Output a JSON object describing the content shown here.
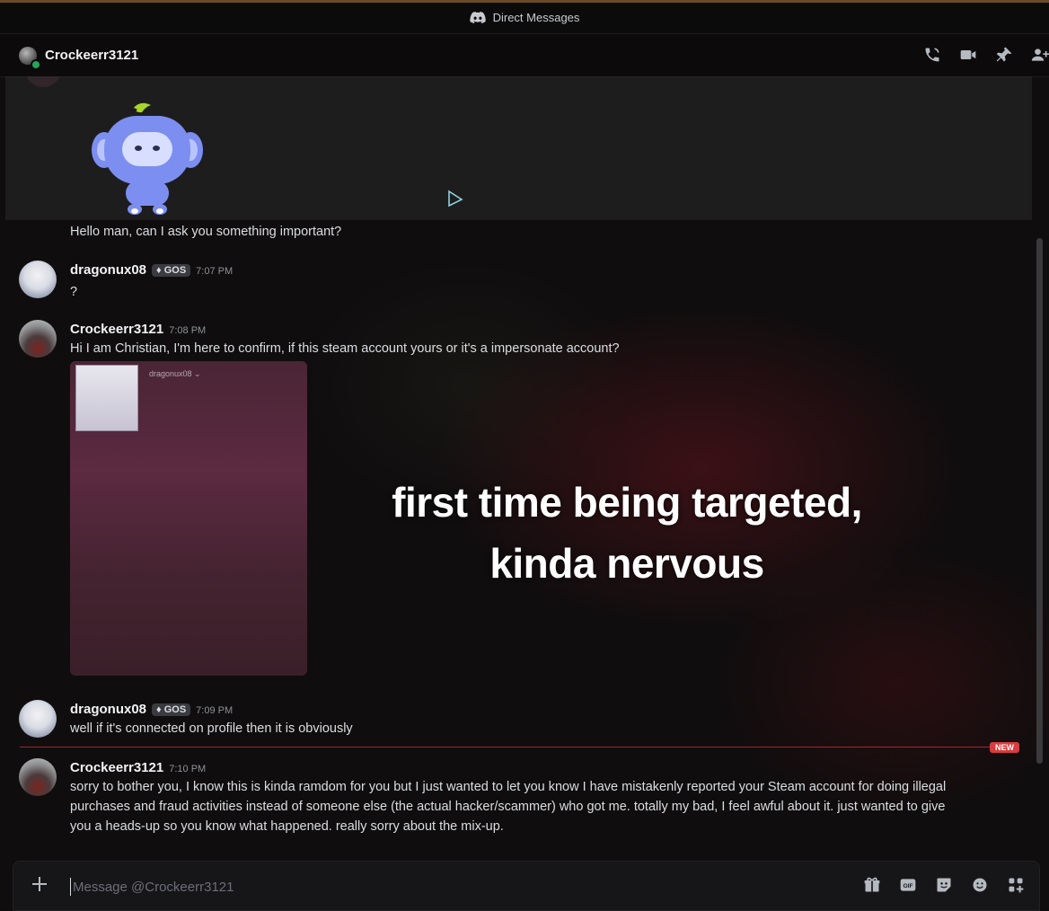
{
  "window": {
    "title": "Direct Messages"
  },
  "header": {
    "username": "Crockeerr3121"
  },
  "messages": [
    {
      "text": "Hello man, can I ask you something important?"
    },
    {
      "username": "dragonux08",
      "badge": "GOS",
      "time": "7:07 PM",
      "text": "?"
    },
    {
      "username": "Crockeerr3121",
      "time": "7:08 PM",
      "text": "Hi I am Christian, I'm here to confirm, if this steam account yours or it's a impersonate account?",
      "attachment_caption": "dragonux08 ⌄"
    },
    {
      "username": "dragonux08",
      "badge": "GOS",
      "time": "7:09 PM",
      "text": "well if it's connected on profile then it is obviously"
    },
    {
      "username": "Crockeerr3121",
      "time": "7:10 PM",
      "lines": [
        "sorry to bother you, I know this is kinda ramdom for you but I just wanted to let you know I have mistakenly reported your Steam account for doing illegal",
        "purchases and fraud activities instead of someone else (the actual hacker/scammer) who got me. totally my bad, I feel awful about it. just wanted to give",
        "you a heads-up so you know what happened. really sorry about the mix-up."
      ]
    }
  ],
  "overlay": {
    "line1": "first time being targeted,",
    "line2": "kinda nervous"
  },
  "new_divider": {
    "label": "NEW"
  },
  "composer": {
    "placeholder": "Message @Crockeerr3121"
  },
  "icons": {
    "header": [
      "phone-call-icon",
      "video-call-icon",
      "pin-icon",
      "add-friend-icon"
    ],
    "composer": [
      "gift-icon",
      "gif-icon",
      "sticker-icon",
      "emoji-icon",
      "apps-icon"
    ]
  },
  "colors": {
    "new_red": "#d83c3e",
    "status_online": "#23a55a",
    "wumpus_blue": "#7c8ff0",
    "leaf_green": "#a8d62a"
  }
}
